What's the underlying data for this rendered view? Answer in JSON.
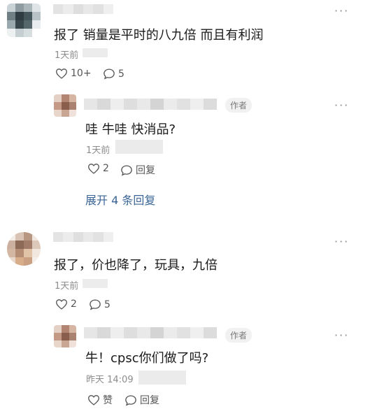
{
  "more_glyph": "···",
  "comments": [
    {
      "content": "报了 销量是平时的八九倍 而且有利润",
      "time": "1天前",
      "likes": "10+",
      "replies": "5",
      "reply": {
        "author_tag": "作者",
        "content": "哇 牛哇 快消品?",
        "time": "1天前",
        "likes": "2",
        "reply_label": "回复",
        "expand_label": "展开 4 条回复"
      }
    },
    {
      "content": "报了，价也降了，玩具，九倍",
      "time": "1天前",
      "likes": "2",
      "replies": "5",
      "reply": {
        "author_tag": "作者",
        "content": "牛！cpsc你们做了吗?",
        "time": "昨天 14:09",
        "like_label": "赞",
        "reply_label": "回复"
      }
    }
  ],
  "colors": {
    "link": "#3a6596",
    "muted": "#8c8c8c"
  }
}
